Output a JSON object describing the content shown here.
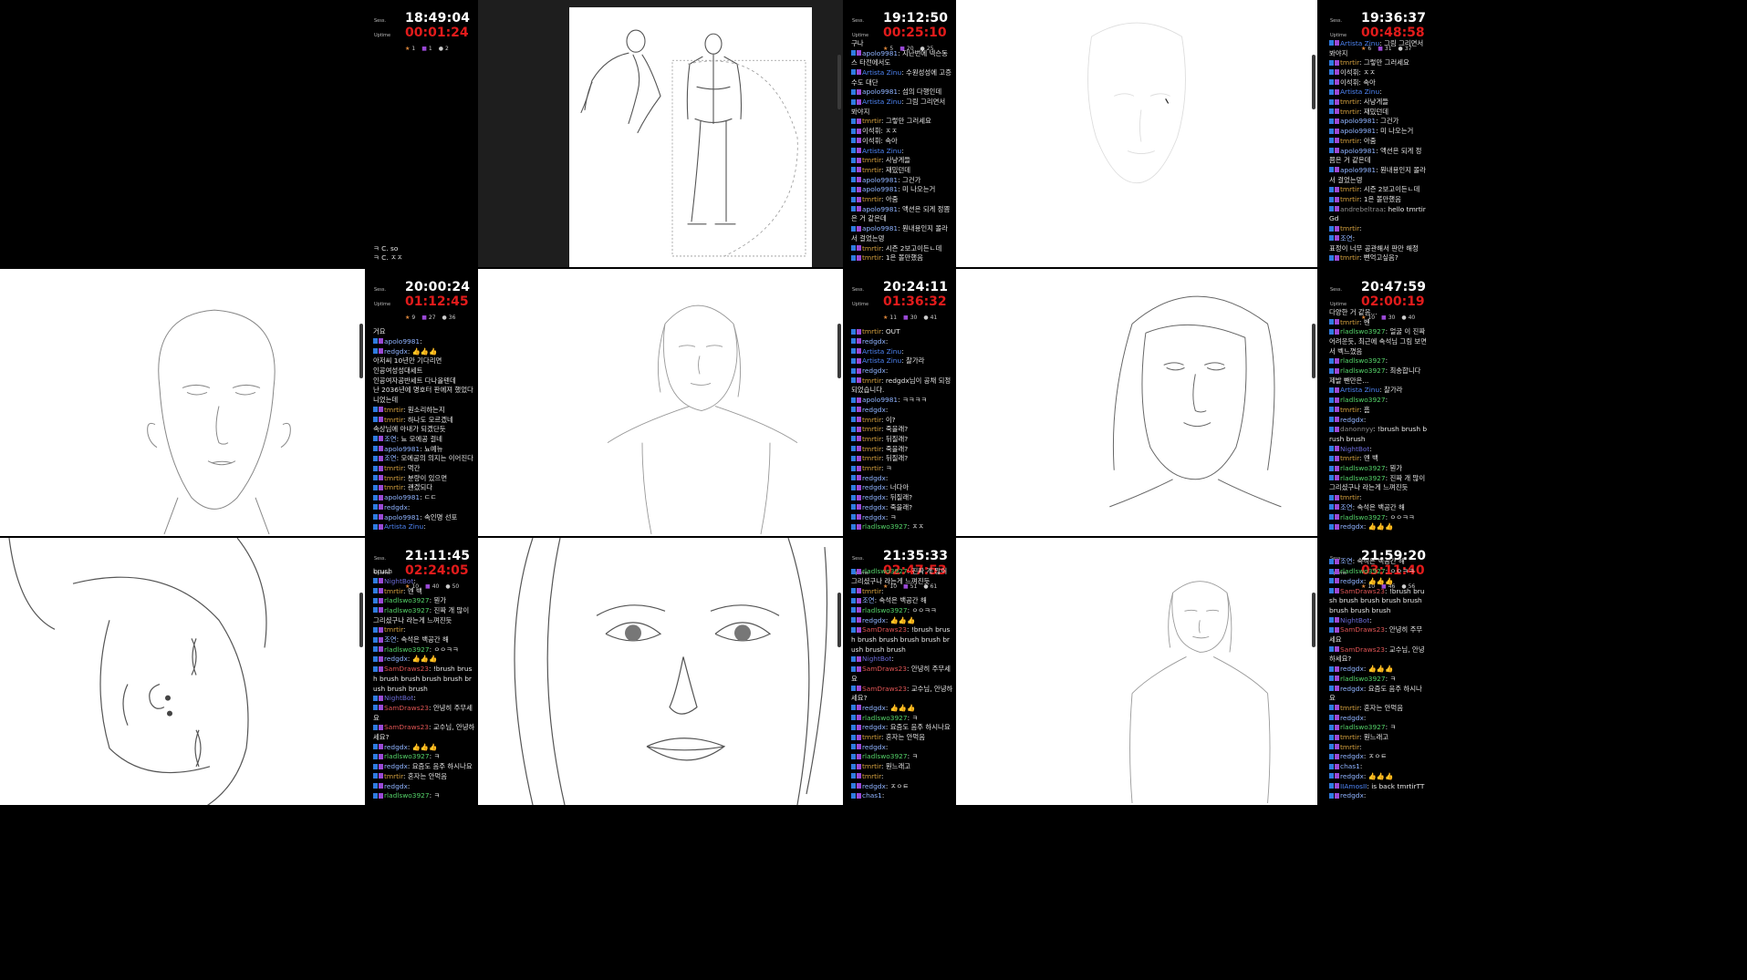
{
  "panels": [
    {
      "row": 0,
      "col": 0,
      "canvas_kind": "black",
      "session": "Sess.",
      "uptime_label": "Uptime",
      "clock": "18:49:04",
      "uptime": "00:01:24",
      "counts": [
        "1",
        "1",
        "2"
      ],
      "chat": [
        {
          "user": "",
          "text": "ㅋ C. so",
          "color": "#e6e6e6"
        },
        {
          "user": "",
          "text": "ㅋ C. ㅈㅈ",
          "color": "#e6e6e6"
        }
      ]
    },
    {
      "row": 0,
      "col": 1,
      "canvas_kind": "gesture",
      "session": "Sess.",
      "uptime_label": "Uptime",
      "clock": "19:12:50",
      "uptime": "00:25:10",
      "counts": [
        "5",
        "20",
        "25"
      ],
      "chat": [
        {
          "user": "",
          "text": "구나",
          "color": "#e6e6e6"
        },
        {
          "user": "apolo9981",
          "text": "지난번에 넥슨동스 타전에서도",
          "color": "#8fb3ff"
        },
        {
          "user": "Artista Zinu",
          "text": "수원성성에 고증수도 대단",
          "color": "#4f86f7"
        },
        {
          "user": "apolo9981",
          "text": "섬의 다행인데",
          "color": "#8fb3ff"
        },
        {
          "user": "Artista Zinu",
          "text": "그림 그리면서 봐야지",
          "color": "#4f86f7"
        },
        {
          "user": "tmrtir",
          "text": "그렇만 그러세요",
          "color": "#d9a441"
        },
        {
          "user": "이석휘",
          "text": "ㅈㅈ",
          "color": "#e6e6e6"
        },
        {
          "user": "이석휘",
          "text": "속아",
          "color": "#e6e6e6"
        },
        {
          "user": "Artista Zinu",
          "text": "",
          "color": "#4f86f7"
        },
        {
          "user": "tmrtir",
          "text": "사냥게들",
          "color": "#d9a441"
        },
        {
          "user": "tmrtir",
          "text": "재밌던데",
          "color": "#d9a441"
        },
        {
          "user": "apolo9981",
          "text": "그건가",
          "color": "#8fb3ff"
        },
        {
          "user": "apolo9981",
          "text": "미 나오는거",
          "color": "#8fb3ff"
        },
        {
          "user": "tmrtir",
          "text": "아줌",
          "color": "#d9a441"
        },
        {
          "user": "apolo9981",
          "text": "액션은 되게 정쁨은 거 같은데",
          "color": "#8fb3ff"
        },
        {
          "user": "apolo9981",
          "text": "뭔내용인지 몰라서 걸었는뎅",
          "color": "#8fb3ff"
        },
        {
          "user": "tmrtir",
          "text": "시즌 2보고이든ㄴ데",
          "color": "#d9a441"
        },
        {
          "user": "tmrtir",
          "text": "1은 볼만했음",
          "color": "#d9a441"
        }
      ]
    },
    {
      "row": 0,
      "col": 2,
      "canvas_kind": "faint-face",
      "session": "Sess.",
      "uptime_label": "Uptime",
      "clock": "19:36:37",
      "uptime": "00:48:58",
      "counts": [
        "6",
        "31",
        "37"
      ],
      "chat": [
        {
          "user": "Artista Zinu",
          "text": "그림 그리면서 봐야지",
          "color": "#4f86f7"
        },
        {
          "user": "tmrtir",
          "text": "그렇만 그러세요",
          "color": "#d9a441"
        },
        {
          "user": "이석휘",
          "text": "ㅈㅈ",
          "color": "#e6e6e6"
        },
        {
          "user": "이석휘",
          "text": "속아",
          "color": "#e6e6e6"
        },
        {
          "user": "Artista Zinu",
          "text": "",
          "color": "#4f86f7"
        },
        {
          "user": "tmrtir",
          "text": "사냥게들",
          "color": "#d9a441"
        },
        {
          "user": "tmrtir",
          "text": "재밌던데",
          "color": "#d9a441"
        },
        {
          "user": "apolo9981",
          "text": "그건가",
          "color": "#8fb3ff"
        },
        {
          "user": "apolo9981",
          "text": "미 나오는거",
          "color": "#8fb3ff"
        },
        {
          "user": "tmrtir",
          "text": "아줌",
          "color": "#d9a441"
        },
        {
          "user": "apolo9981",
          "text": "액션은 되게 정쁨은 거 같은데",
          "color": "#8fb3ff"
        },
        {
          "user": "apolo9981",
          "text": "뭔내용인지 몰라서 걸었는뎅",
          "color": "#8fb3ff"
        },
        {
          "user": "tmrtir",
          "text": "시즌 2보고이든ㄴ데",
          "color": "#d9a441"
        },
        {
          "user": "tmrtir",
          "text": "1은 볼만했음",
          "color": "#d9a441"
        },
        {
          "user": "andrebeltraa",
          "text": "hello tmrtirGd",
          "color": "#8a8a8a"
        },
        {
          "user": "tmrtir",
          "text": "",
          "color": "#d9a441"
        },
        {
          "user": "조연",
          "text": "",
          "color": "#8fb3ff"
        },
        {
          "user": "",
          "text": "표정이 너무 공관해서 판만 해정",
          "color": "#e6e6e6"
        },
        {
          "user": "tmrtir",
          "text": "뻔억고싶음?",
          "color": "#d9a441"
        }
      ]
    },
    {
      "row": 1,
      "col": 0,
      "canvas_kind": "bald-head",
      "session": "Sess.",
      "uptime_label": "Uptime",
      "clock": "20:00:24",
      "uptime": "01:12:45",
      "counts": [
        "9",
        "27",
        "36"
      ],
      "chat": [
        {
          "user": "",
          "text": "거요",
          "color": "#e6e6e6"
        },
        {
          "user": "apolo9981",
          "text": "",
          "color": "#8fb3ff"
        },
        {
          "user": "redgdx",
          "text": "👍👍👍",
          "color": "#8fb3ff"
        },
        {
          "user": "",
          "text": "아저씨 10년만 기다리면",
          "color": "#e6e6e6"
        },
        {
          "user": "",
          "text": "인공여성성대세트",
          "color": "#e6e6e6"
        },
        {
          "user": "",
          "text": "인공여자공반세트 다나올텐데",
          "color": "#e6e6e6"
        },
        {
          "user": "",
          "text": "난 2036년에 명호터 판에져 했었다니었는데",
          "color": "#e6e6e6"
        },
        {
          "user": "tmrtir",
          "text": "뭔소리하는지",
          "color": "#d9a441"
        },
        {
          "user": "tmrtir",
          "text": "하나도 모르겠네",
          "color": "#d9a441"
        },
        {
          "user": "",
          "text": "속상님에 아내가 되겠단듯",
          "color": "#e6e6e6"
        },
        {
          "user": "조연",
          "text": "뇨 모에공 걸네",
          "color": "#8fb3ff"
        },
        {
          "user": "apolo9981",
          "text": "뇨예뉴",
          "color": "#8fb3ff"
        },
        {
          "user": "조연",
          "text": "모에공의 의지는 이어진다",
          "color": "#8fb3ff"
        },
        {
          "user": "tmrtir",
          "text": "먹간",
          "color": "#d9a441"
        },
        {
          "user": "tmrtir",
          "text": "분량이 있으면",
          "color": "#d9a441"
        },
        {
          "user": "tmrtir",
          "text": "괜겠되다",
          "color": "#d9a441"
        },
        {
          "user": "apolo9981",
          "text": "ㄷㄷ",
          "color": "#8fb3ff"
        },
        {
          "user": "redgdx",
          "text": "",
          "color": "#8fb3ff"
        },
        {
          "user": "apolo9981",
          "text": "속인명 선포",
          "color": "#8fb3ff"
        },
        {
          "user": "Artista Zinu",
          "text": "",
          "color": "#4f86f7"
        }
      ]
    },
    {
      "row": 1,
      "col": 1,
      "canvas_kind": "bob-figure",
      "session": "Sess.",
      "uptime_label": "Uptime",
      "clock": "20:24:11",
      "uptime": "01:36:32",
      "counts": [
        "11",
        "30",
        "41"
      ],
      "chat": [
        {
          "user": "tmrtir",
          "text": "OUT",
          "color": "#d9a441"
        },
        {
          "user": "redgdx",
          "text": "",
          "color": "#8fb3ff"
        },
        {
          "user": "Artista Zinu",
          "text": "",
          "color": "#4f86f7"
        },
        {
          "user": "Artista Zinu",
          "text": "찰가라",
          "color": "#4f86f7"
        },
        {
          "user": "redgdx",
          "text": "",
          "color": "#8fb3ff"
        },
        {
          "user": "tmrtir",
          "text": "redgdx님이 공채 되정 되었습니다.",
          "color": "#d9a441"
        },
        {
          "user": "apolo9981",
          "text": "ㅋㅋㅋㅋ",
          "color": "#8fb3ff"
        },
        {
          "user": "redgdx",
          "text": "",
          "color": "#8fb3ff"
        },
        {
          "user": "tmrtir",
          "text": "이?",
          "color": "#d9a441"
        },
        {
          "user": "tmrtir",
          "text": "죽을래?",
          "color": "#d9a441"
        },
        {
          "user": "tmrtir",
          "text": "뒤질래?",
          "color": "#d9a441"
        },
        {
          "user": "tmrtir",
          "text": "죽을래?",
          "color": "#d9a441"
        },
        {
          "user": "tmrtir",
          "text": "뒤질래?",
          "color": "#d9a441"
        },
        {
          "user": "tmrtir",
          "text": "ㅋ",
          "color": "#d9a441"
        },
        {
          "user": "redgdx",
          "text": "",
          "color": "#8fb3ff"
        },
        {
          "user": "redgdx",
          "text": "너다아",
          "color": "#8fb3ff"
        },
        {
          "user": "redgdx",
          "text": "뒤질래?",
          "color": "#8fb3ff"
        },
        {
          "user": "redgdx",
          "text": "죽을래?",
          "color": "#8fb3ff"
        },
        {
          "user": "redgdx",
          "text": "ㅋ",
          "color": "#8fb3ff"
        },
        {
          "user": "rladlswo3927",
          "text": "ㅈㅈ",
          "color": "#55d46a"
        }
      ]
    },
    {
      "row": 1,
      "col": 2,
      "canvas_kind": "hair-face",
      "session": "Sess.",
      "uptime_label": "Uptime",
      "clock": "20:47:59",
      "uptime": "02:00:19",
      "counts": [
        "10",
        "30",
        "40"
      ],
      "chat": [
        {
          "user": "",
          "text": "다양한 거 같음...",
          "color": "#e6e6e6"
        },
        {
          "user": "tmrtir",
          "text": "벤",
          "color": "#d9a441"
        },
        {
          "user": "rladlswo3927",
          "text": "얼굴 이 진짜 어려운듯, 최근에 속석님 그림 보면서 벡느꼈음",
          "color": "#55d46a"
        },
        {
          "user": "rladlswo3927",
          "text": "",
          "color": "#55d46a"
        },
        {
          "user": "rladlswo3927",
          "text": "최송합니다 제발 뺀만은...",
          "color": "#55d46a"
        },
        {
          "user": "Artista Zinu",
          "text": "찰가라",
          "color": "#4f86f7"
        },
        {
          "user": "rladlswo3927",
          "text": "",
          "color": "#55d46a"
        },
        {
          "user": "tmrtir",
          "text": "흠",
          "color": "#d9a441"
        },
        {
          "user": "redgdx",
          "text": "",
          "color": "#8fb3ff"
        },
        {
          "user": "danonnyy",
          "text": "!brush brush brush brush",
          "color": "#8a8a8a"
        },
        {
          "user": "NightBot",
          "text": "",
          "color": "#6b6bd6"
        },
        {
          "user": "tmrtir",
          "text": "멘 백",
          "color": "#d9a441"
        },
        {
          "user": "rladlswo3927",
          "text": "뭔가",
          "color": "#55d46a"
        },
        {
          "user": "rladlswo3927",
          "text": "진짜 개 많이 그리셨구나 라는게 느껴진듯",
          "color": "#55d46a"
        },
        {
          "user": "tmrtir",
          "text": "",
          "color": "#d9a441"
        },
        {
          "user": "조연",
          "text": "속석은 백공간 해",
          "color": "#8fb3ff"
        },
        {
          "user": "rladlswo3927",
          "text": "ㅇㅇㅋㅋ",
          "color": "#55d46a"
        },
        {
          "user": "redgdx",
          "text": "👍👍👍",
          "color": "#8fb3ff"
        }
      ]
    },
    {
      "row": 2,
      "col": 0,
      "canvas_kind": "rotated-face",
      "session": "Sess.",
      "uptime_label": "Uptime",
      "clock": "21:11:45",
      "uptime": "02:24:05",
      "counts": [
        "10",
        "40",
        "50"
      ],
      "chat": [
        {
          "user": "",
          "text": "brush",
          "color": "#e6e6e6"
        },
        {
          "user": "NightBot",
          "text": "",
          "color": "#6b6bd6"
        },
        {
          "user": "tmrtir",
          "text": "멘 백",
          "color": "#d9a441"
        },
        {
          "user": "rladlswo3927",
          "text": "뭔가",
          "color": "#55d46a"
        },
        {
          "user": "rladlswo3927",
          "text": "진짜 개 많이 그리셨구나 라는게 느껴진듯",
          "color": "#55d46a"
        },
        {
          "user": "tmrtir",
          "text": "",
          "color": "#d9a441"
        },
        {
          "user": "조연",
          "text": "속석은 백공간 해",
          "color": "#8fb3ff"
        },
        {
          "user": "rladlswo3927",
          "text": "ㅇㅇㅋㅋ",
          "color": "#55d46a"
        },
        {
          "user": "redgdx",
          "text": "👍👍👍",
          "color": "#8fb3ff"
        },
        {
          "user": "SamDraws23",
          "text": "!brush brush brush brush brush brush brush brush brush",
          "color": "#e05555"
        },
        {
          "user": "NightBot",
          "text": "",
          "color": "#6b6bd6"
        },
        {
          "user": "SamDraws23",
          "text": "안녕히 주무세요",
          "color": "#e05555"
        },
        {
          "user": "SamDraws23",
          "text": "교수님, 안녕하세요?",
          "color": "#e05555"
        },
        {
          "user": "redgdx",
          "text": "👍👍👍",
          "color": "#8fb3ff"
        },
        {
          "user": "rladlswo3927",
          "text": "ㅋ",
          "color": "#55d46a"
        },
        {
          "user": "redgdx",
          "text": "요즘도 음주 하시나요",
          "color": "#8fb3ff"
        },
        {
          "user": "tmrtir",
          "text": "혼자는 안먹음",
          "color": "#d9a441"
        },
        {
          "user": "redgdx",
          "text": "",
          "color": "#8fb3ff"
        },
        {
          "user": "rladlswo3927",
          "text": "ㅋ",
          "color": "#55d46a"
        }
      ]
    },
    {
      "row": 2,
      "col": 1,
      "canvas_kind": "closeup-face",
      "session": "Sess.",
      "uptime_label": "Uptime",
      "clock": "21:35:33",
      "uptime": "02:47:53",
      "counts": [
        "10",
        "51",
        "61"
      ],
      "chat": [
        {
          "user": "rladlswo3927",
          "text": "진짜 개 많이 그리셨구나 라는게 느껴진듯",
          "color": "#55d46a"
        },
        {
          "user": "tmrtir",
          "text": "",
          "color": "#d9a441"
        },
        {
          "user": "조연",
          "text": "속석은 백공간 해",
          "color": "#8fb3ff"
        },
        {
          "user": "rladlswo3927",
          "text": "ㅇㅇㅋㅋ",
          "color": "#55d46a"
        },
        {
          "user": "redgdx",
          "text": "👍👍👍",
          "color": "#8fb3ff"
        },
        {
          "user": "SamDraws23",
          "text": "!brush brush brush brush brush brush brush brush brush",
          "color": "#e05555"
        },
        {
          "user": "NightBot",
          "text": "",
          "color": "#6b6bd6"
        },
        {
          "user": "SamDraws23",
          "text": "안녕히 주무세요",
          "color": "#e05555"
        },
        {
          "user": "SamDraws23",
          "text": "교수님, 안녕하세요?",
          "color": "#e05555"
        },
        {
          "user": "redgdx",
          "text": "👍👍👍",
          "color": "#8fb3ff"
        },
        {
          "user": "rladlswo3927",
          "text": "ㅋ",
          "color": "#55d46a"
        },
        {
          "user": "redgdx",
          "text": "요즘도 음주 하시나요",
          "color": "#8fb3ff"
        },
        {
          "user": "tmrtir",
          "text": "혼자는 안먹음",
          "color": "#d9a441"
        },
        {
          "user": "redgdx",
          "text": "",
          "color": "#8fb3ff"
        },
        {
          "user": "rladlswo3927",
          "text": "ㅋ",
          "color": "#55d46a"
        },
        {
          "user": "tmrtir",
          "text": "뭔느래고",
          "color": "#d9a441"
        },
        {
          "user": "tmrtir",
          "text": "",
          "color": "#d9a441"
        },
        {
          "user": "redgdx",
          "text": "ㅈㅇㅌ",
          "color": "#8fb3ff"
        },
        {
          "user": "chas1",
          "text": "",
          "color": "#8fb3ff"
        }
      ]
    },
    {
      "row": 2,
      "col": 2,
      "canvas_kind": "small-figure",
      "session": "Sess.",
      "uptime_label": "Uptime",
      "clock": "21:59:20",
      "uptime": "03:11:40",
      "counts": [
        "10",
        "46",
        "56"
      ],
      "chat": [
        {
          "user": "조연",
          "text": "속석은 백공간 해",
          "color": "#8fb3ff"
        },
        {
          "user": "rladlswo3927",
          "text": "ㅇㅇㅋㅋ",
          "color": "#55d46a"
        },
        {
          "user": "redgdx",
          "text": "👍👍👍",
          "color": "#8fb3ff"
        },
        {
          "user": "SamDraws23",
          "text": "!brush brush brush brush brush brush brush brush brush",
          "color": "#e05555"
        },
        {
          "user": "NightBot",
          "text": "",
          "color": "#6b6bd6"
        },
        {
          "user": "SamDraws23",
          "text": "안녕히 주무세요",
          "color": "#e05555"
        },
        {
          "user": "SamDraws23",
          "text": "교수님, 안녕하세요?",
          "color": "#e05555"
        },
        {
          "user": "redgdx",
          "text": "👍👍👍",
          "color": "#8fb3ff"
        },
        {
          "user": "rladlswo3927",
          "text": "ㅋ",
          "color": "#55d46a"
        },
        {
          "user": "redgdx",
          "text": "요즘도 음주 하시나요",
          "color": "#8fb3ff"
        },
        {
          "user": "tmrtir",
          "text": "혼자는 안먹음",
          "color": "#d9a441"
        },
        {
          "user": "redgdx",
          "text": "",
          "color": "#8fb3ff"
        },
        {
          "user": "rladlswo3927",
          "text": "ㅋ",
          "color": "#55d46a"
        },
        {
          "user": "tmrtir",
          "text": "뭔느래고",
          "color": "#d9a441"
        },
        {
          "user": "tmrtir",
          "text": "",
          "color": "#d9a441"
        },
        {
          "user": "redgdx",
          "text": "ㅈㅇㅌ",
          "color": "#8fb3ff"
        },
        {
          "user": "chas1",
          "text": "",
          "color": "#8fb3ff"
        },
        {
          "user": "redgdx",
          "text": "👍👍👍",
          "color": "#8fb3ff"
        },
        {
          "user": "IIAmosII",
          "text": "is back tmrtirTT",
          "color": "#4f86f7"
        },
        {
          "user": "redgdx",
          "text": "",
          "color": "#8fb3ff"
        }
      ]
    }
  ],
  "colors": {
    "uptime": "#e21b1b",
    "clock": "#ffffff",
    "background": "#000000",
    "badge_mod": "#2f7be0",
    "badge_sub": "#9a49d6",
    "badge_vip": "#e0883b"
  }
}
